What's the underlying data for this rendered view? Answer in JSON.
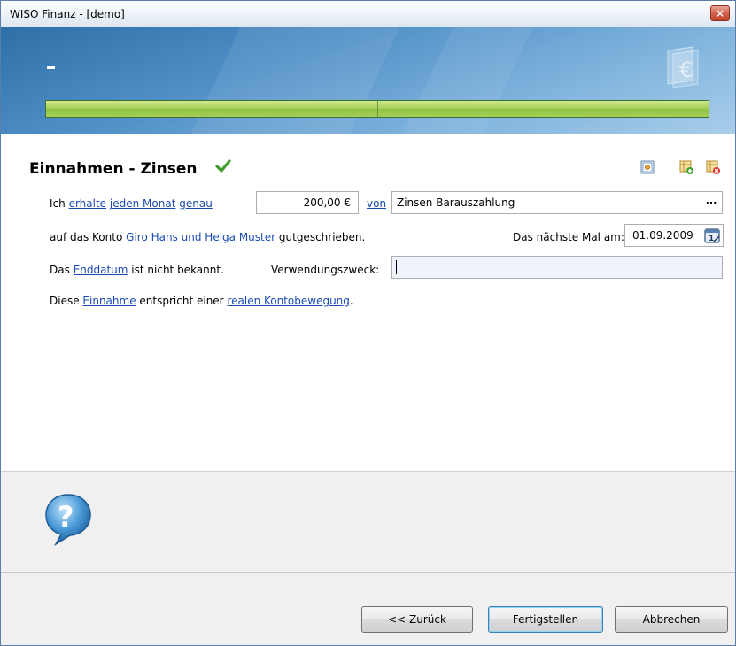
{
  "window": {
    "title": "WISO Finanz - [demo]",
    "close_label": "×"
  },
  "banner": {
    "step_label": "",
    "progress_value": 1.0
  },
  "section": {
    "title": "Einnahmen - Zinsen"
  },
  "row1": {
    "ich": "Ich",
    "erhalte": "erhalte",
    "jeden_monat": "jeden Monat",
    "genau": "genau",
    "amount": "200,00 €",
    "von": "von",
    "source": "Zinsen Barauszahlung",
    "ellipsis": "..."
  },
  "row2": {
    "prefix": "auf das Konto",
    "account": "Giro Hans und Helga Muster",
    "suffix": "gutgeschrieben.",
    "next_label": "Das nächste Mal am:",
    "next_date": "01.09.2009"
  },
  "row3": {
    "das": "Das",
    "enddatum": "Enddatum",
    "nicht_bekannt": "ist nicht bekannt.",
    "verwendung_label": "Verwendungszweck:",
    "verwendung_value": ""
  },
  "row4": {
    "diese": "Diese",
    "einnahme": "Einnahme",
    "entspricht": "entspricht einer",
    "kontobewegung": "realen Kontobewegung",
    "dot": "."
  },
  "footer": {
    "back": "<< Zurück",
    "finish": "Fertigstellen",
    "cancel": "Abbrechen"
  },
  "colors": {
    "link": "#1a4bb3",
    "progress": "#a9d25a",
    "banner": "#4f8fc6"
  },
  "icons": [
    "check-icon",
    "settings-icon",
    "add-icon",
    "delete-icon",
    "calendar-icon",
    "help-icon",
    "euro-logo-icon"
  ]
}
